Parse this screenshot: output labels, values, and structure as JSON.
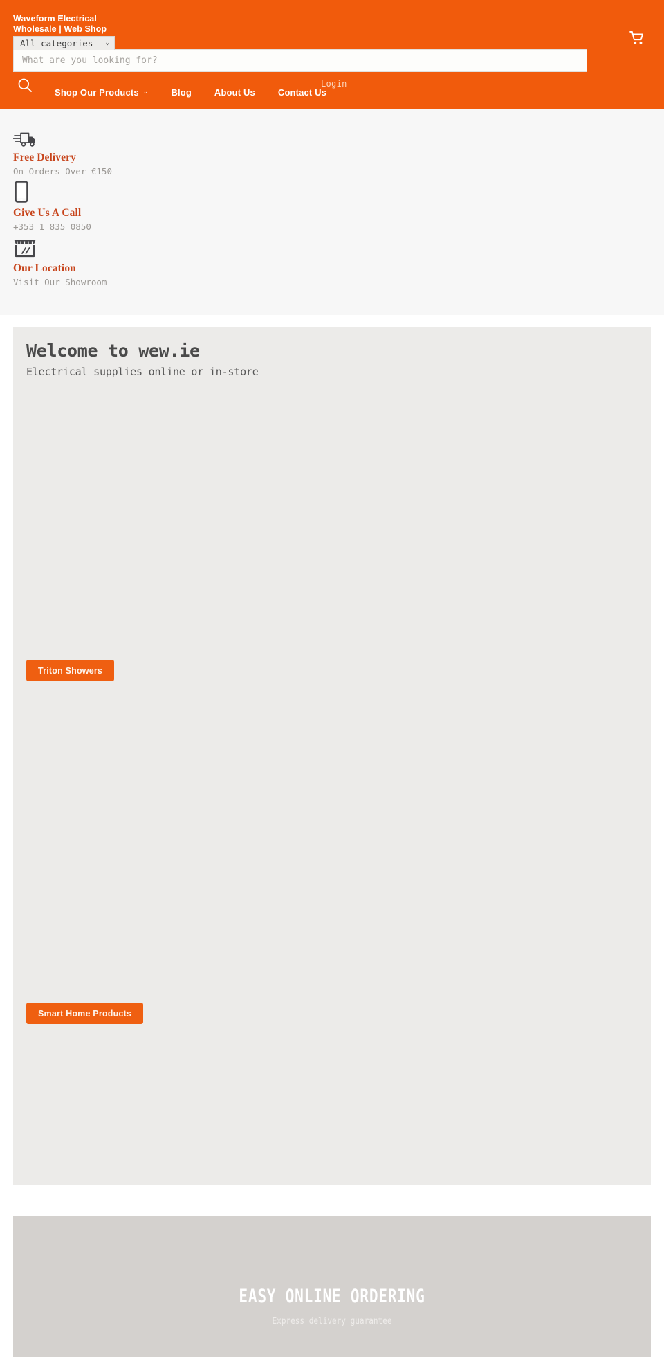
{
  "header": {
    "brand_line1": "Waveform Electrical",
    "brand_line2": "Wholesale | Web Shop",
    "cart_icon": "shopping-cart-icon",
    "search": {
      "category_label": "All categories",
      "category_chevron": "⌄",
      "placeholder": "What are you looking for?",
      "value": "",
      "search_icon": "search-icon"
    },
    "login_label": "Login",
    "nav": [
      {
        "label": "Shop Our Products",
        "has_chevron": true,
        "chevron": "⌄"
      },
      {
        "label": "Blog",
        "has_chevron": false,
        "chevron": ""
      },
      {
        "label": "About Us",
        "has_chevron": false,
        "chevron": ""
      },
      {
        "label": "Contact Us",
        "has_chevron": false,
        "chevron": ""
      }
    ],
    "accent_color": "#F15B0C"
  },
  "features": [
    {
      "icon": "delivery-truck-icon",
      "title": "Free Delivery",
      "subtitle": "On Orders Over €150"
    },
    {
      "icon": "mobile-phone-icon",
      "title": "Give Us A Call",
      "subtitle": "+353 1 835 0850"
    },
    {
      "icon": "storefront-icon",
      "title": "Our Location",
      "subtitle": "Visit Our Showroom"
    }
  ],
  "hero": {
    "title": "Welcome to wew.ie",
    "subtitle": "Electrical supplies online or in-store",
    "button_1": "Triton Showers",
    "button_2": "Smart Home Products",
    "background_color": "#ECEBE9",
    "button_color": "#EF5F11"
  },
  "promo": {
    "title": "EASY ONLINE ORDERING",
    "subtitle": "Express delivery guarantee",
    "background_color": "#D4D1CE"
  },
  "colors": {
    "brand_orange": "#F15B0C",
    "feature_title": "#C7441B",
    "features_bg": "#F7F7F7"
  }
}
